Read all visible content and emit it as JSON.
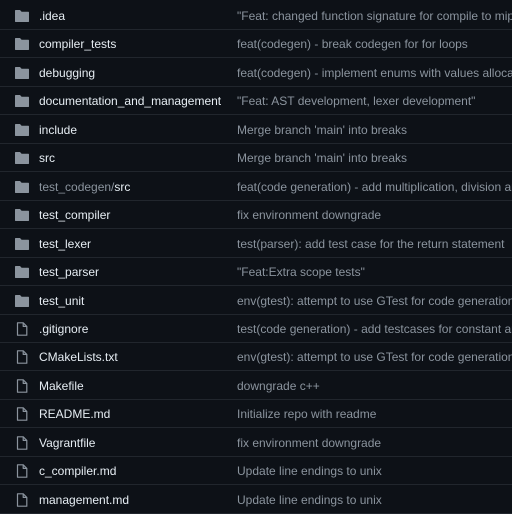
{
  "colors": {
    "background": "#0d1117",
    "border": "#21262d",
    "file_name": "#e6edf3",
    "muted": "#8b949e",
    "folder_icon": "#8b949e"
  },
  "rows": [
    {
      "type": "folder",
      "icon": "folder-icon",
      "name": ".idea",
      "message": "\"Feat: changed function signature for compile to mips\""
    },
    {
      "type": "folder",
      "icon": "folder-icon",
      "name": "compiler_tests",
      "message": "feat(codegen) - break codegen for for loops"
    },
    {
      "type": "folder",
      "icon": "folder-icon",
      "name": "debugging",
      "message": "feat(codegen) - implement enums with values allocation co"
    },
    {
      "type": "folder",
      "icon": "folder-icon",
      "name": "documentation_and_management",
      "message": "\"Feat: AST development, lexer development\""
    },
    {
      "type": "folder",
      "icon": "folder-icon",
      "name": "include",
      "message": "Merge branch 'main' into breaks"
    },
    {
      "type": "folder",
      "icon": "folder-icon",
      "name": "src",
      "message": "Merge branch 'main' into breaks"
    },
    {
      "type": "folder",
      "icon": "folder-icon",
      "name_prefix": "test_codegen/",
      "name": "src",
      "message": "feat(code generation) - add multiplication, division and mo"
    },
    {
      "type": "folder",
      "icon": "folder-icon",
      "name": "test_compiler",
      "message": "fix environment downgrade"
    },
    {
      "type": "folder",
      "icon": "folder-icon",
      "name": "test_lexer",
      "message": "test(parser): add test case for the return statement"
    },
    {
      "type": "folder",
      "icon": "folder-icon",
      "name": "test_parser",
      "message": "\"Feat:Extra scope tests\""
    },
    {
      "type": "folder",
      "icon": "folder-icon",
      "name": "test_unit",
      "message": "env(gtest): attempt to use GTest for code generation"
    },
    {
      "type": "file",
      "icon": "file-icon",
      "name": ".gitignore",
      "message": "test(code generation) - add testcases for constant and var"
    },
    {
      "type": "file",
      "icon": "file-icon",
      "name": "CMakeLists.txt",
      "message": "env(gtest): attempt to use GTest for code generation"
    },
    {
      "type": "file",
      "icon": "file-icon",
      "name": "Makefile",
      "message": "downgrade c++"
    },
    {
      "type": "file",
      "icon": "file-icon",
      "name": "README.md",
      "message": "Initialize repo with readme"
    },
    {
      "type": "file",
      "icon": "file-icon",
      "name": "Vagrantfile",
      "message": "fix environment downgrade"
    },
    {
      "type": "file",
      "icon": "file-icon",
      "name": "c_compiler.md",
      "message": "Update line endings to unix"
    },
    {
      "type": "file",
      "icon": "file-icon",
      "name": "management.md",
      "message": "Update line endings to unix"
    }
  ]
}
